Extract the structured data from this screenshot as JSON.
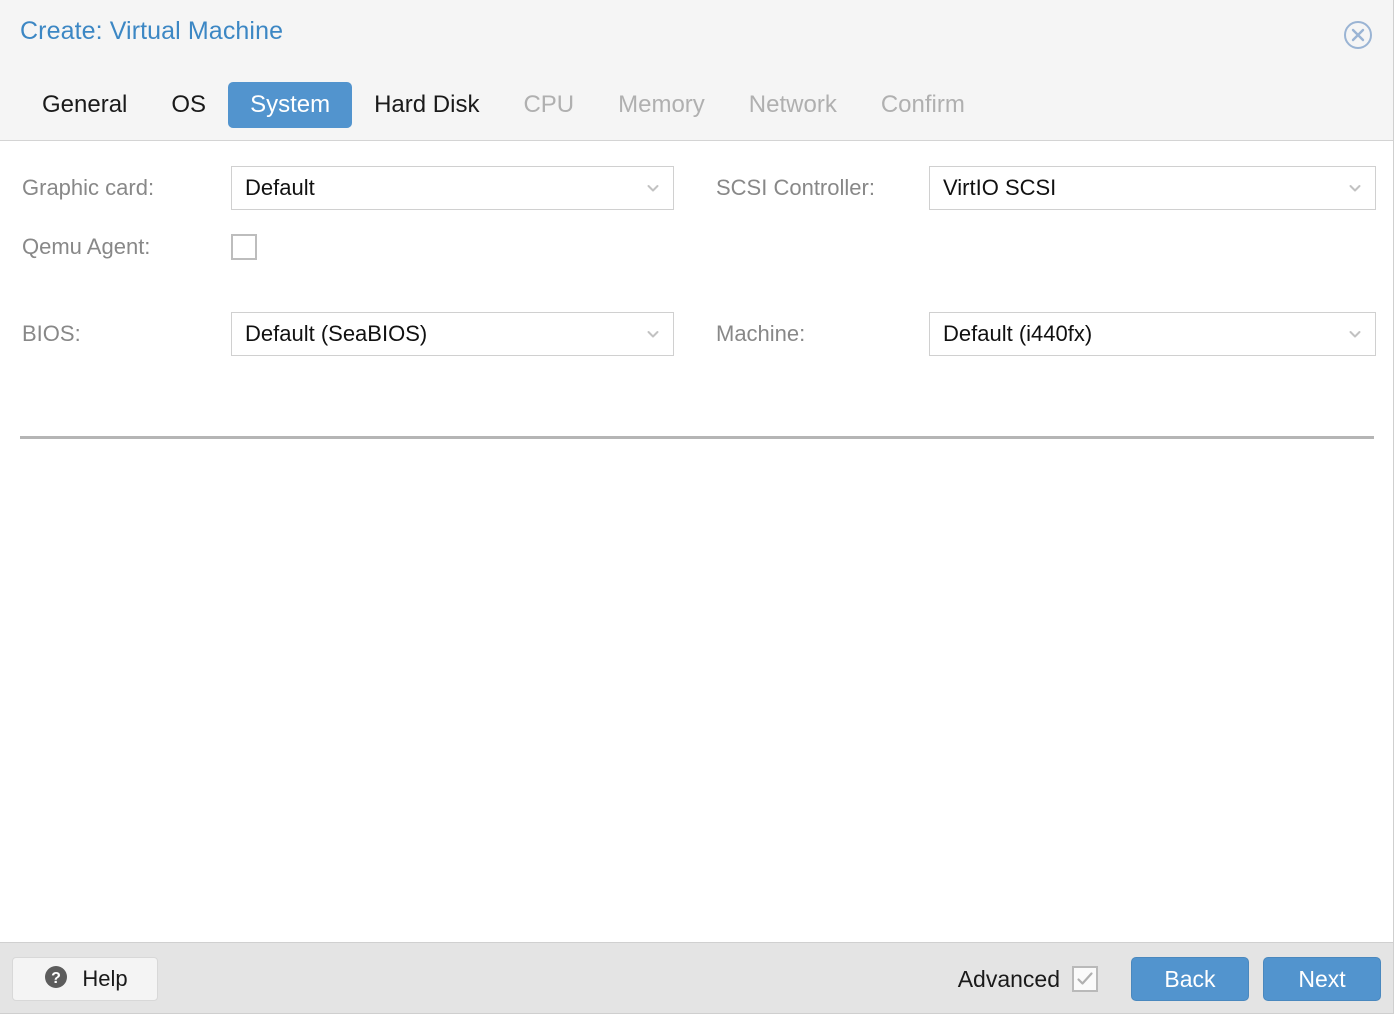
{
  "dialog": {
    "title": "Create: Virtual Machine",
    "close_icon": "close-circle-icon",
    "accent_color": "#5294ce",
    "title_color": "#3c87c4"
  },
  "tabs": [
    {
      "label": "General",
      "state": "enabled"
    },
    {
      "label": "OS",
      "state": "enabled"
    },
    {
      "label": "System",
      "state": "active"
    },
    {
      "label": "Hard Disk",
      "state": "enabled"
    },
    {
      "label": "CPU",
      "state": "disabled"
    },
    {
      "label": "Memory",
      "state": "disabled"
    },
    {
      "label": "Network",
      "state": "disabled"
    },
    {
      "label": "Confirm",
      "state": "disabled"
    }
  ],
  "form": {
    "graphic_card": {
      "label": "Graphic card:",
      "value": "Default"
    },
    "qemu_agent": {
      "label": "Qemu Agent:",
      "checked": false
    },
    "scsi_controller": {
      "label": "SCSI Controller:",
      "value": "VirtIO SCSI"
    },
    "bios": {
      "label": "BIOS:",
      "value": "Default (SeaBIOS)"
    },
    "machine": {
      "label": "Machine:",
      "value": "Default (i440fx)"
    }
  },
  "footer": {
    "help_label": "Help",
    "help_icon": "question-mark-circle-icon",
    "advanced_label": "Advanced",
    "advanced_checked": true,
    "back_label": "Back",
    "next_label": "Next"
  }
}
